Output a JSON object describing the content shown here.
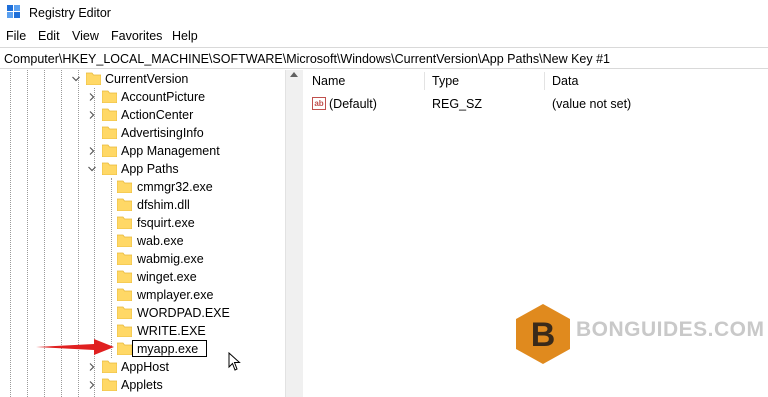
{
  "window": {
    "title": "Registry Editor"
  },
  "menu": {
    "file": "File",
    "edit": "Edit",
    "view": "View",
    "favorites": "Favorites",
    "help": "Help"
  },
  "address": "Computer\\HKEY_LOCAL_MACHINE\\SOFTWARE\\Microsoft\\Windows\\CurrentVersion\\App Paths\\New Key #1",
  "tree": {
    "current_version": "CurrentVersion",
    "items": [
      "AccountPicture",
      "ActionCenter",
      "AdvertisingInfo",
      "App Management",
      "App Paths"
    ],
    "app_paths_children": [
      "cmmgr32.exe",
      "dfshim.dll",
      "fsquirt.exe",
      "wab.exe",
      "wabmig.exe",
      "winget.exe",
      "wmplayer.exe",
      "WORDPAD.EXE",
      "WRITE.EXE"
    ],
    "rename_value": "myapp.exe",
    "after": [
      "AppHost",
      "Applets"
    ]
  },
  "list": {
    "columns": {
      "name": "Name",
      "type": "Type",
      "data": "Data"
    },
    "rows": [
      {
        "name": "(Default)",
        "type": "REG_SZ",
        "data": "(value not set)"
      }
    ]
  },
  "watermark": {
    "letter": "B",
    "text": "BONGUIDES.COM"
  },
  "colors": {
    "folder": "#ffd866",
    "folder_dark": "#e8b93a",
    "arrow": "#e02020",
    "watermark_hex": "#e08a1e"
  }
}
